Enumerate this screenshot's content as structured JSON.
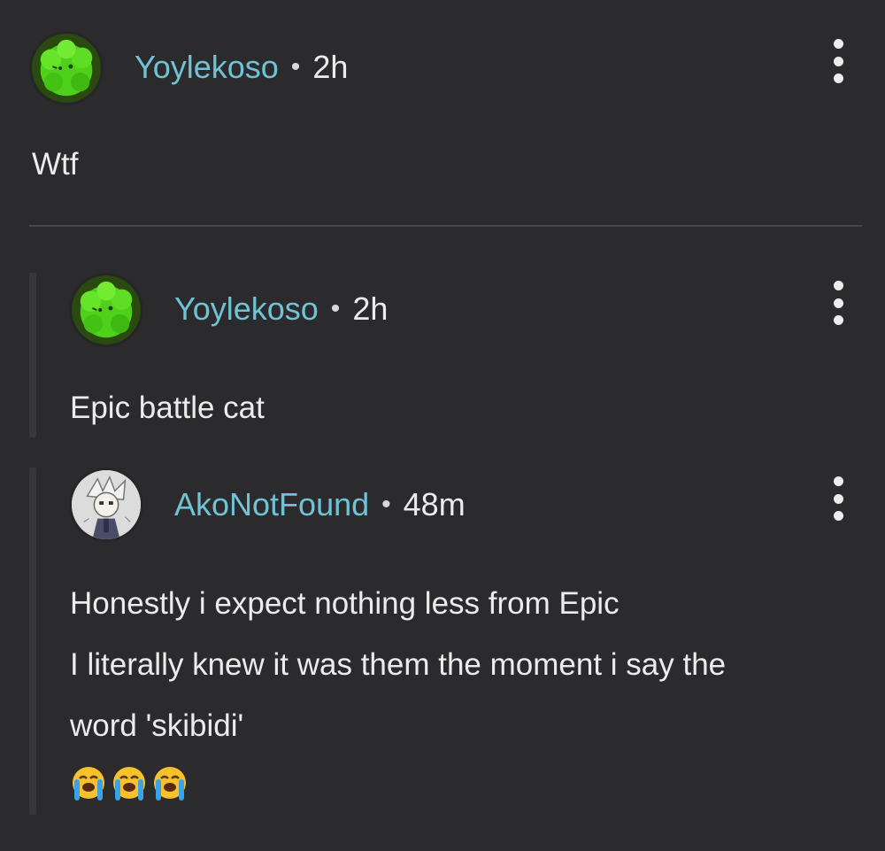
{
  "comments": [
    {
      "username": "Yoylekoso",
      "separator": "•",
      "time": "2h",
      "text": "Wtf",
      "avatar": "green-bush-avatar"
    },
    {
      "username": "Yoylekoso",
      "separator": "•",
      "time": "2h",
      "text": "Epic battle cat",
      "avatar": "green-bush-avatar"
    },
    {
      "username": "AkoNotFound",
      "separator": "•",
      "time": "48m",
      "lines": [
        "Honestly i expect nothing less from Epic",
        "I literally knew it was them the moment i say the",
        "word 'skibidi'"
      ],
      "emoji": [
        "😭",
        "😭",
        "😭"
      ],
      "avatar": "anime-character-avatar"
    }
  ],
  "colors": {
    "background": "#2b2b2e",
    "username": "#71c2d4",
    "text": "#ececec",
    "divider": "#48484c"
  }
}
